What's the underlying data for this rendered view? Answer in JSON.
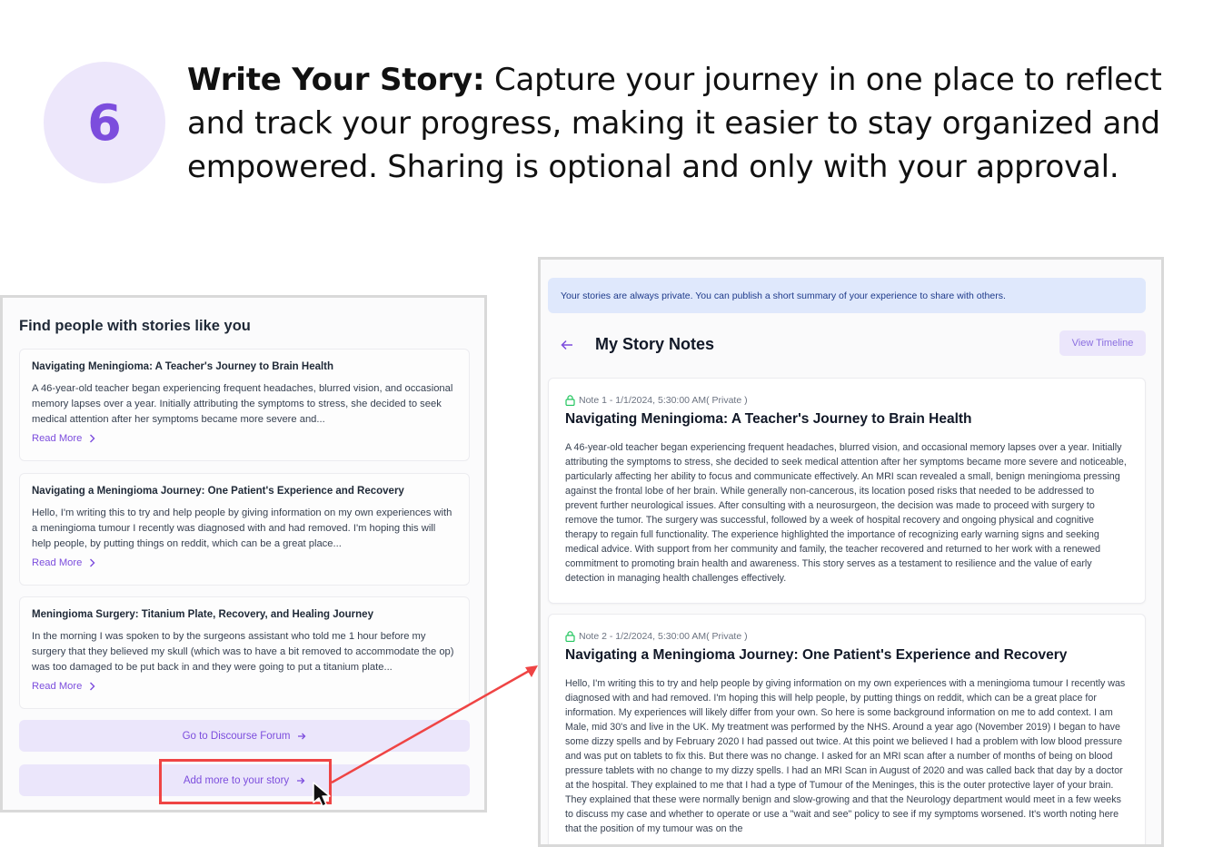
{
  "step": {
    "number": "6",
    "title": "Write Your Story:",
    "description": " Capture your journey in one place to reflect and track your progress, making it easier to stay organized and empowered. Sharing is optional and only with your approval."
  },
  "left_panel": {
    "title": "Find people with stories like you",
    "stories": [
      {
        "title": "Navigating Meningioma: A Teacher's Journey to Brain Health",
        "excerpt": "A 46-year-old teacher began experiencing frequent headaches, blurred vision, and occasional memory lapses over a year. Initially attributing the symptoms to stress, she decided to seek medical attention after her symptoms became more severe and...",
        "link": "Read More"
      },
      {
        "title": "Navigating a Meningioma Journey: One Patient's Experience and Recovery",
        "excerpt": "Hello, I'm writing this to try and help people by giving information on my own experiences with a meningioma tumour I recently was diagnosed with and had removed. I'm hoping this will help people, by putting things on reddit, which can be a great place...",
        "link": "Read More"
      },
      {
        "title": "Meningioma Surgery: Titanium Plate, Recovery, and Healing Journey",
        "excerpt": "In the morning I was spoken to by the surgeons assistant who told me 1 hour before my surgery that they believed my skull (which was to have a bit removed to accommodate the op) was too damaged to be put back in and they were going to put a titanium plate...",
        "link": "Read More"
      }
    ],
    "forum_button": "Go to Discourse Forum",
    "add_story_button": "Add more to your story"
  },
  "right_panel": {
    "banner": "Your stories are always private. You can publish a short summary of your experience to share with others.",
    "title": "My Story Notes",
    "timeline_button": "View Timeline",
    "notes": [
      {
        "meta": "Note 1 - 1/1/2024, 5:30:00 AM( Private )",
        "title": "Navigating Meningioma: A Teacher's Journey to Brain Health",
        "body": "A 46-year-old teacher began experiencing frequent headaches, blurred vision, and occasional memory lapses over a year. Initially attributing the symptoms to stress, she decided to seek medical attention after her symptoms became more severe and noticeable, particularly affecting her ability to focus and communicate effectively. An MRI scan revealed a small, benign meningioma pressing against the frontal lobe of her brain. While generally non-cancerous, its location posed risks that needed to be addressed to prevent further neurological issues. After consulting with a neurosurgeon, the decision was made to proceed with surgery to remove the tumor. The surgery was successful, followed by a week of hospital recovery and ongoing physical and cognitive therapy to regain full functionality. The experience highlighted the importance of recognizing early warning signs and seeking medical advice. With support from her community and family, the teacher recovered and returned to her work with a renewed commitment to promoting brain health and awareness. This story serves as a testament to resilience and the value of early detection in managing health challenges effectively."
      },
      {
        "meta": "Note 2 - 1/2/2024, 5:30:00 AM( Private )",
        "title": "Navigating a Meningioma Journey: One Patient's Experience and Recovery",
        "body": "Hello, I'm writing this to try and help people by giving information on my own experiences with a meningioma tumour I recently was diagnosed with and had removed. I'm hoping this will help people, by putting things on reddit, which can be a great place for information. My experiences will likely differ from your own. So here is some background information on me to add context. I am Male, mid 30's and live in the UK. My treatment was performed by the NHS. Around a year ago (November 2019) I began to have some dizzy spells and by February 2020 I had passed out twice. At this point we believed I had a problem with low blood pressure and was put on tablets to fix this. But there was no change. I asked for an MRI scan after a number of months of being on blood pressure tablets with no change to my dizzy spells. I had an MRI Scan in August of 2020 and was called back that day by a doctor at the hospital. They explained to me that I had a type of Tumour of the Meninges, this is the outer protective layer of your brain. They explained that these were normally benign and slow-growing and that the Neurology department would meet in a few weeks to discuss my case and whether to operate or use a \"wait and see\" policy to see if my symptoms worsened. It's worth noting here that the position of my tumour was on the"
      }
    ]
  },
  "colors": {
    "accent": "#7c4ddd",
    "highlight": "#ef4444",
    "banner_bg": "#dfe8fc",
    "button_bg": "#ebe6fb"
  }
}
